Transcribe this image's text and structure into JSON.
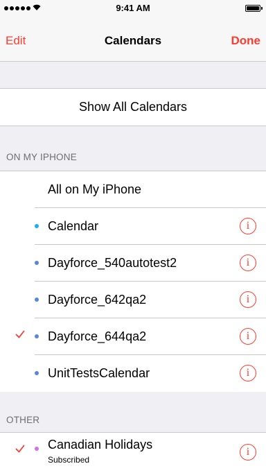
{
  "status_bar": {
    "time": "9:41 AM"
  },
  "nav": {
    "edit_label": "Edit",
    "title": "Calendars",
    "done_label": "Done"
  },
  "show_all_label": "Show All Calendars",
  "sections": {
    "on_my_iphone": {
      "header": "ON MY IPHONE",
      "all_label": "All on My iPhone",
      "items": [
        {
          "label": "Calendar",
          "color": "#1badf8",
          "checked": false
        },
        {
          "label": "Dayforce_540autotest2",
          "color": "#5b86d6",
          "checked": false
        },
        {
          "label": "Dayforce_642qa2",
          "color": "#5b86d6",
          "checked": false
        },
        {
          "label": "Dayforce_644qa2",
          "color": "#5b86d6",
          "checked": true
        },
        {
          "label": "UnitTestsCalendar",
          "color": "#5b86d6",
          "checked": false
        }
      ]
    },
    "other": {
      "header": "OTHER",
      "items": [
        {
          "label": "Canadian Holidays",
          "sublabel": "Subscribed",
          "color": "#cc73e1",
          "checked": true
        }
      ]
    }
  },
  "info_glyph": "i",
  "colors": {
    "accent": "#ff3b30",
    "separator": "#c8c7cc",
    "background": "#efeff4"
  }
}
